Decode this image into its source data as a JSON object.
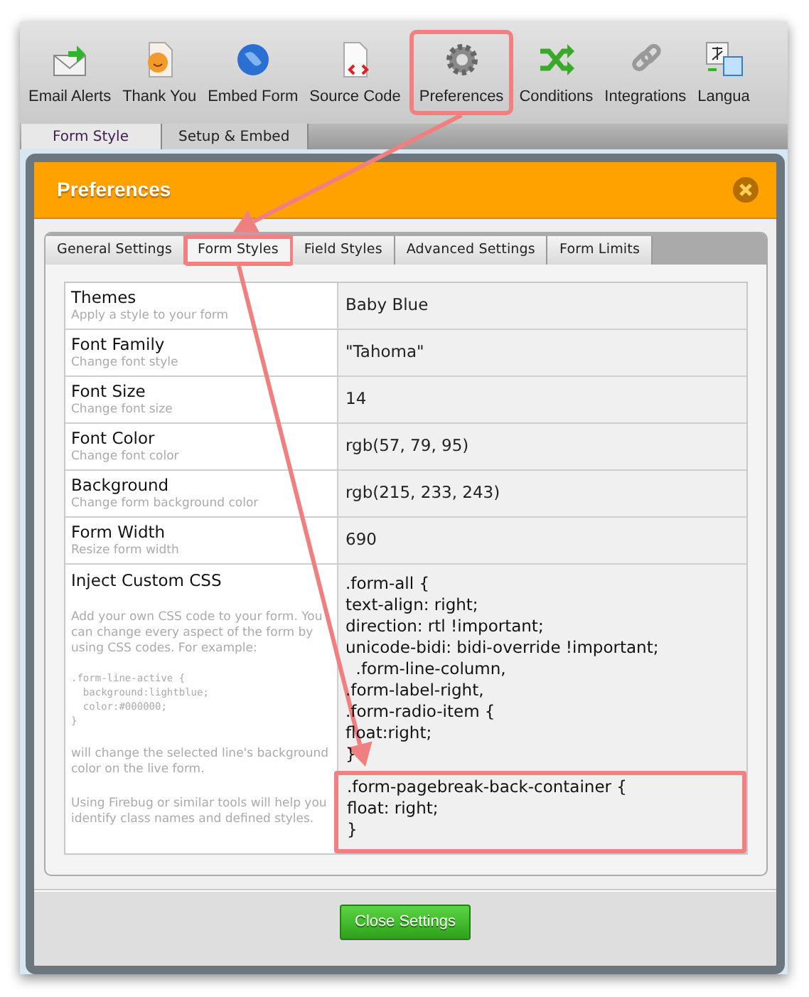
{
  "toolbar": {
    "items": [
      {
        "label": "Email Alerts",
        "highlighted": false
      },
      {
        "label": "Thank You",
        "highlighted": false
      },
      {
        "label": "Embed Form",
        "highlighted": false
      },
      {
        "label": "Source Code",
        "highlighted": false
      },
      {
        "label": "Preferences",
        "highlighted": true
      },
      {
        "label": "Conditions",
        "highlighted": false
      },
      {
        "label": "Integrations",
        "highlighted": false
      },
      {
        "label": "Langua",
        "highlighted": false
      }
    ]
  },
  "page_tabs": [
    {
      "label": "Form Style",
      "selected": true
    },
    {
      "label": "Setup & Embed",
      "selected": false
    }
  ],
  "dialog": {
    "title": "Preferences",
    "tabs": [
      {
        "label": "General Settings",
        "selected": false,
        "highlighted": false
      },
      {
        "label": "Form Styles",
        "selected": true,
        "highlighted": true
      },
      {
        "label": "Field Styles",
        "selected": false,
        "highlighted": false
      },
      {
        "label": "Advanced Settings",
        "selected": false,
        "highlighted": false
      },
      {
        "label": "Form Limits",
        "selected": false,
        "highlighted": false
      }
    ],
    "settings": [
      {
        "label": "Themes",
        "hint": "Apply a style to your form",
        "value": "Baby Blue"
      },
      {
        "label": "Font Family",
        "hint": "Change font style",
        "value": "\"Tahoma\""
      },
      {
        "label": "Font Size",
        "hint": "Change font size",
        "value": "14"
      },
      {
        "label": "Font Color",
        "hint": "Change font color",
        "value": "rgb(57, 79, 95)"
      },
      {
        "label": "Background",
        "hint": "Change form background color",
        "value": "rgb(215, 233, 243)"
      },
      {
        "label": "Form Width",
        "hint": "Resize form width",
        "value": "690"
      }
    ],
    "custom_css": {
      "label": "Inject Custom CSS",
      "help": [
        "Add your own CSS code to your form. You can change every aspect of the form by using CSS codes. For example:",
        "will change the selected line's background color on the live form.",
        "Using Firebug or similar tools will help you identify class names and defined styles."
      ],
      "example": [
        ".form-line-active {",
        "  background:lightblue;",
        "  color:#000000;",
        "}"
      ],
      "lines": [
        ".form-all {",
        "text-align: right;",
        "direction: rtl !important;",
        "unicode-bidi: bidi-override !important;",
        "  .form-line-column,",
        ".form-label-right,",
        ".form-radio-item {",
        "float:right;",
        "}"
      ],
      "highlighted_lines": [
        ".form-pagebreak-back-container {",
        "float: right;",
        "}"
      ]
    },
    "close_button": "Close Settings"
  }
}
